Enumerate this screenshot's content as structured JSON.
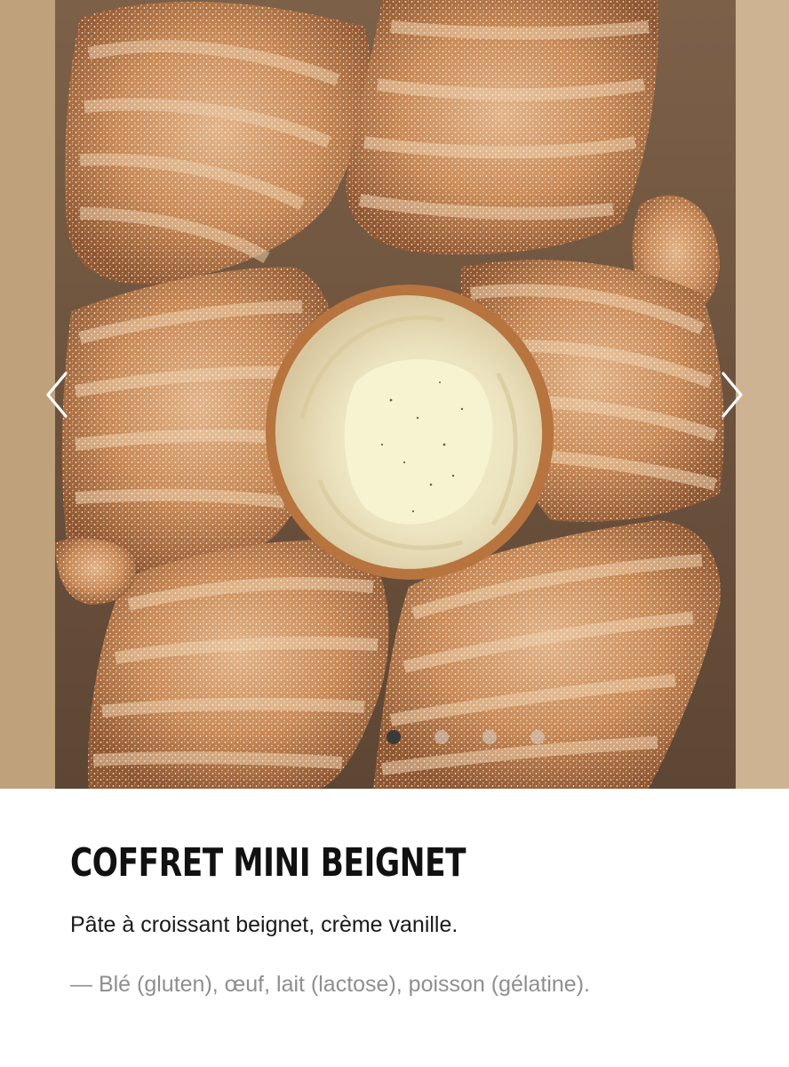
{
  "carousel": {
    "image_alt": "Coffret mini beignet",
    "slide_count": 4,
    "active_index": 0,
    "prev_icon": "chevron-left-icon",
    "next_icon": "chevron-right-icon",
    "arrow_color": "#ffffff",
    "dot_active_color": "#3a3a3a",
    "dot_inactive_color": "#d8d2cc"
  },
  "product": {
    "title": "COFFRET MINI BEIGNET",
    "description": "Pâte à croissant beignet, crème vanille.",
    "allergens": "— Blé (gluten), œuf, lait (lactose), poisson (gélatine)."
  },
  "colors": {
    "box_kraft": "#c9ad89",
    "beignet_crust": "#c98a56",
    "crumb": "#efe8c8",
    "title_text": "#111111",
    "body_text": "#1a1a1a",
    "muted_text": "#8f8f8f"
  }
}
